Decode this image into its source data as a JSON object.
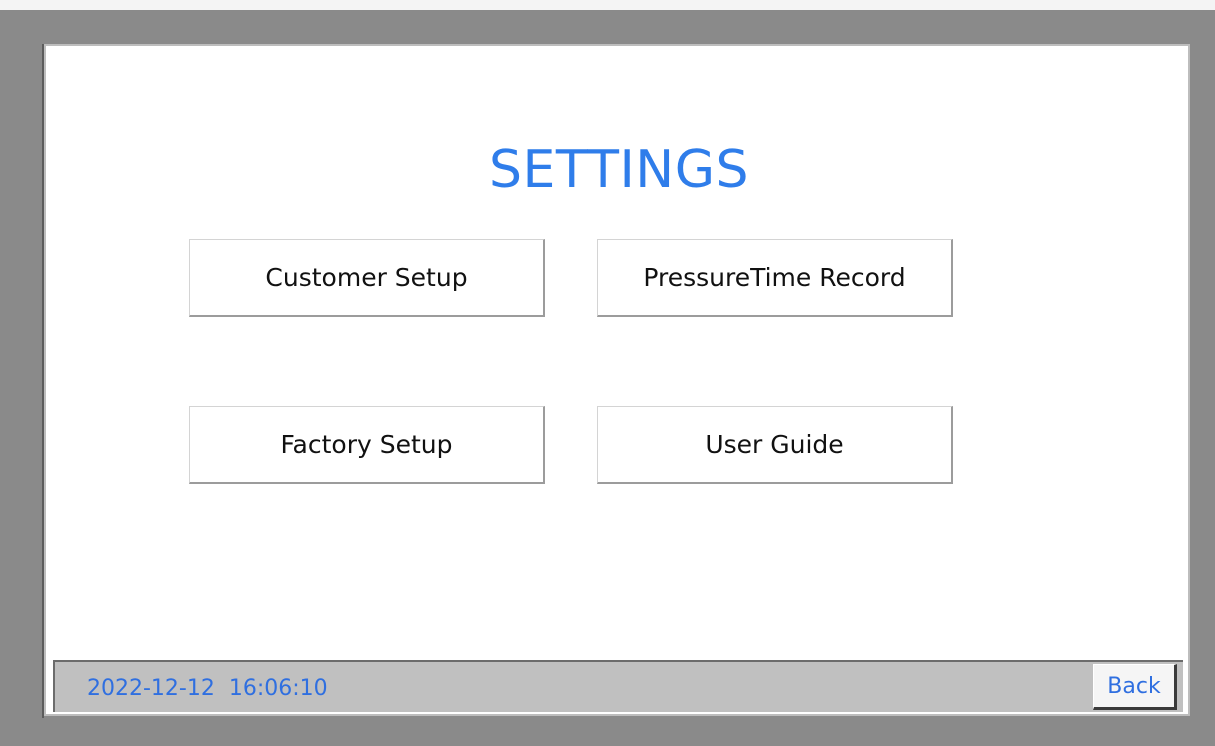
{
  "screen": {
    "title": "SETTINGS"
  },
  "menu": {
    "customer_setup": "Customer Setup",
    "pressure_time_record": "PressureTime Record",
    "factory_setup": "Factory Setup",
    "user_guide": "User Guide"
  },
  "status_bar": {
    "datetime": "2022-12-12  16:06:10",
    "back_label": "Back"
  },
  "colors": {
    "accent": "#2f7dea",
    "bezel": "#8a8a8a",
    "status_bar": "#c0c0c0"
  }
}
